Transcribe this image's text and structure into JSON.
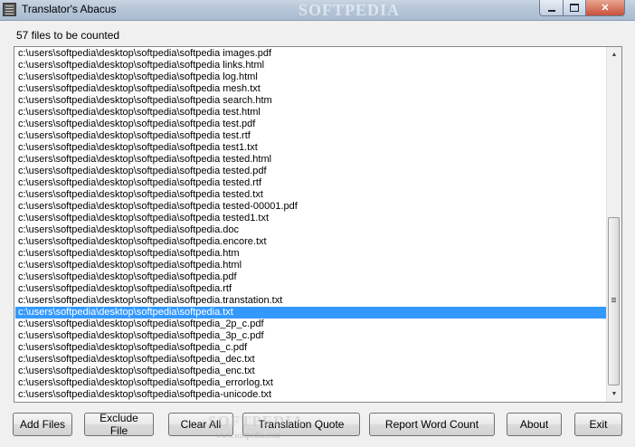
{
  "window": {
    "title": "Translator's Abacus",
    "watermark": "SOFTPEDIA",
    "controls": {
      "minimize": "minimize",
      "maximize": "maximize",
      "close": "✕"
    }
  },
  "main": {
    "count_label": "57 files to be counted",
    "selected_index": 22,
    "files": [
      "c:\\users\\softpedia\\desktop\\softpedia\\softpedia images.pdf",
      "c:\\users\\softpedia\\desktop\\softpedia\\softpedia links.html",
      "c:\\users\\softpedia\\desktop\\softpedia\\softpedia log.html",
      "c:\\users\\softpedia\\desktop\\softpedia\\softpedia mesh.txt",
      "c:\\users\\softpedia\\desktop\\softpedia\\softpedia search.htm",
      "c:\\users\\softpedia\\desktop\\softpedia\\softpedia test.html",
      "c:\\users\\softpedia\\desktop\\softpedia\\softpedia test.pdf",
      "c:\\users\\softpedia\\desktop\\softpedia\\softpedia test.rtf",
      "c:\\users\\softpedia\\desktop\\softpedia\\softpedia test1.txt",
      "c:\\users\\softpedia\\desktop\\softpedia\\softpedia tested.html",
      "c:\\users\\softpedia\\desktop\\softpedia\\softpedia tested.pdf",
      "c:\\users\\softpedia\\desktop\\softpedia\\softpedia tested.rtf",
      "c:\\users\\softpedia\\desktop\\softpedia\\softpedia tested.txt",
      "c:\\users\\softpedia\\desktop\\softpedia\\softpedia tested-00001.pdf",
      "c:\\users\\softpedia\\desktop\\softpedia\\softpedia tested1.txt",
      "c:\\users\\softpedia\\desktop\\softpedia\\softpedia.doc",
      "c:\\users\\softpedia\\desktop\\softpedia\\softpedia.encore.txt",
      "c:\\users\\softpedia\\desktop\\softpedia\\softpedia.htm",
      "c:\\users\\softpedia\\desktop\\softpedia\\softpedia.html",
      "c:\\users\\softpedia\\desktop\\softpedia\\softpedia.pdf",
      "c:\\users\\softpedia\\desktop\\softpedia\\softpedia.rtf",
      "c:\\users\\softpedia\\desktop\\softpedia\\softpedia.transtation.txt",
      "c:\\users\\softpedia\\desktop\\softpedia\\softpedia.txt",
      "c:\\users\\softpedia\\desktop\\softpedia\\softpedia_2p_c.pdf",
      "c:\\users\\softpedia\\desktop\\softpedia\\softpedia_3p_c.pdf",
      "c:\\users\\softpedia\\desktop\\softpedia\\softpedia_c.pdf",
      "c:\\users\\softpedia\\desktop\\softpedia\\softpedia_dec.txt",
      "c:\\users\\softpedia\\desktop\\softpedia\\softpedia_enc.txt",
      "c:\\users\\softpedia\\desktop\\softpedia\\softpedia_errorlog.txt",
      "c:\\users\\softpedia\\desktop\\softpedia\\softpedia-unicode.txt"
    ]
  },
  "buttons": {
    "add_files": "Add Files",
    "exclude_file": "Exclude File",
    "clear_all": "Clear All",
    "translation_quote": "Translation Quote",
    "report_word_count": "Report Word Count",
    "about": "About",
    "exit": "Exit"
  },
  "footer": {
    "watermark": "SOFTPEDIA",
    "watermark_url": "www.softpedia.com"
  }
}
